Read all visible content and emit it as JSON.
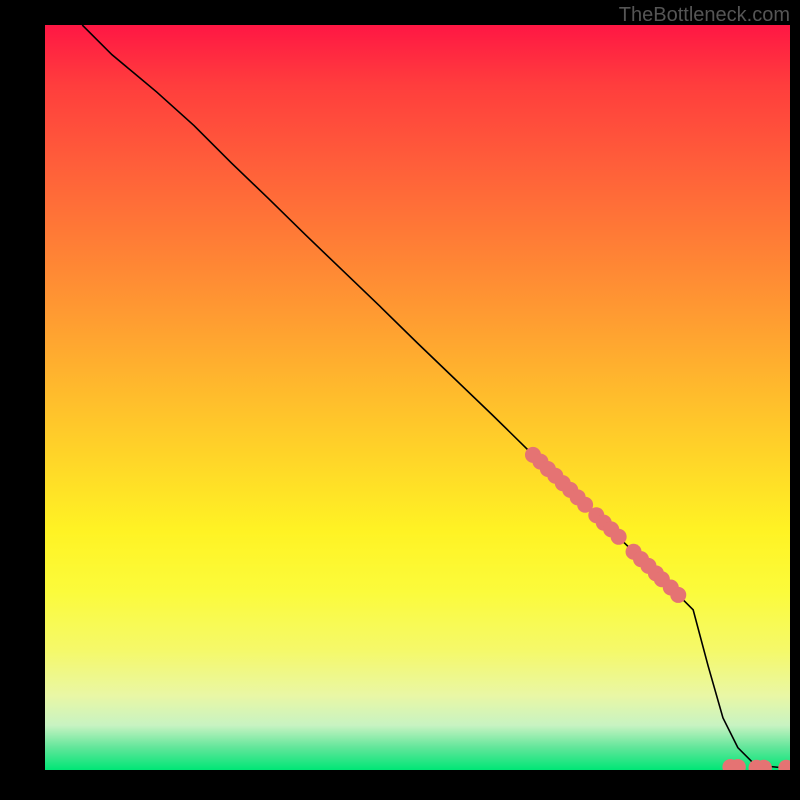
{
  "watermark": "TheBottleneck.com",
  "chart_data": {
    "type": "line",
    "title": "",
    "xlabel": "",
    "ylabel": "",
    "xlim": [
      0,
      100
    ],
    "ylim": [
      0,
      100
    ],
    "series": [
      {
        "name": "curve",
        "x": [
          5,
          7,
          9,
          12,
          15,
          20,
          25,
          30,
          35,
          40,
          45,
          50,
          55,
          60,
          65,
          70,
          75,
          80,
          85,
          87,
          89,
          91,
          93,
          95,
          97,
          99,
          100
        ],
        "y": [
          100,
          98,
          96,
          93.5,
          91,
          86.5,
          81.5,
          76.7,
          71.8,
          67,
          62.2,
          57.3,
          52.5,
          47.7,
          42.8,
          38,
          33.2,
          28.3,
          23.5,
          21.5,
          14,
          7,
          3,
          1,
          0.5,
          0.3,
          0.3
        ]
      }
    ],
    "dots": {
      "color": "#e57373",
      "points": [
        {
          "x": 65.5,
          "y": 42.3
        },
        {
          "x": 66.5,
          "y": 41.4
        },
        {
          "x": 67.5,
          "y": 40.4
        },
        {
          "x": 68.5,
          "y": 39.5
        },
        {
          "x": 69.5,
          "y": 38.5
        },
        {
          "x": 70.5,
          "y": 37.6
        },
        {
          "x": 71.5,
          "y": 36.6
        },
        {
          "x": 72.5,
          "y": 35.6
        },
        {
          "x": 74.0,
          "y": 34.2
        },
        {
          "x": 75.0,
          "y": 33.2
        },
        {
          "x": 76.0,
          "y": 32.3
        },
        {
          "x": 77.0,
          "y": 31.3
        },
        {
          "x": 79.0,
          "y": 29.3
        },
        {
          "x": 80.0,
          "y": 28.3
        },
        {
          "x": 81.0,
          "y": 27.4
        },
        {
          "x": 82.0,
          "y": 26.4
        },
        {
          "x": 82.8,
          "y": 25.6
        },
        {
          "x": 84.0,
          "y": 24.5
        },
        {
          "x": 85.0,
          "y": 23.5
        },
        {
          "x": 92.0,
          "y": 0.4
        },
        {
          "x": 93.0,
          "y": 0.4
        },
        {
          "x": 95.5,
          "y": 0.3
        },
        {
          "x": 96.5,
          "y": 0.3
        },
        {
          "x": 99.5,
          "y": 0.3
        }
      ]
    }
  }
}
